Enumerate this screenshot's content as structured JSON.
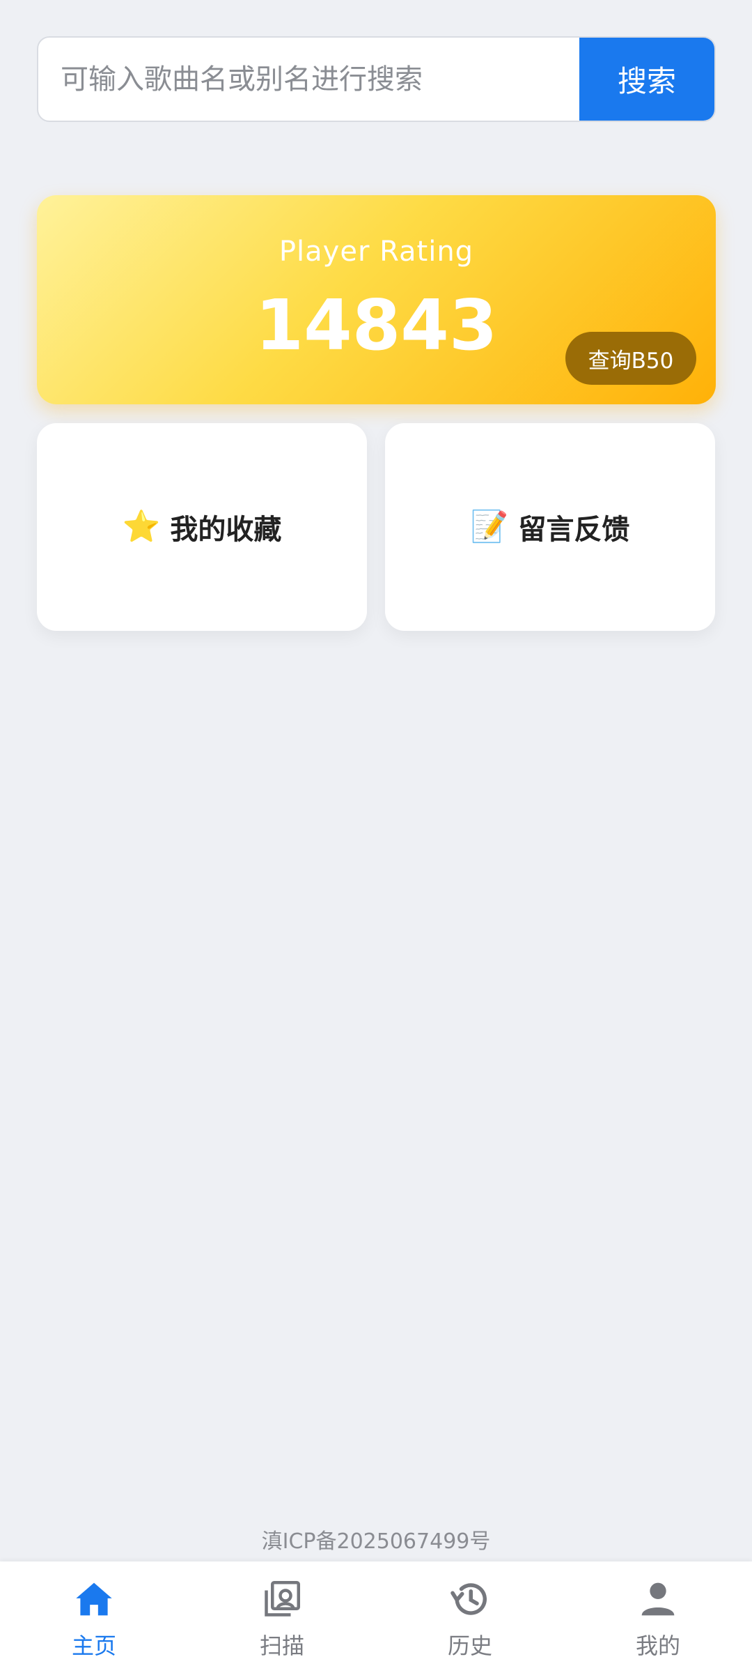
{
  "search": {
    "placeholder": "可输入歌曲名或别名进行搜索",
    "button_label": "搜索"
  },
  "rating_card": {
    "label": "Player Rating",
    "value": "14843",
    "button_label": "查询B50"
  },
  "features": [
    {
      "icon": "⭐",
      "label": "我的收藏"
    },
    {
      "icon": "📝",
      "label": "留言反馈"
    }
  ],
  "footer": {
    "icp": "滇ICP备2025067499号"
  },
  "bottom_nav": {
    "items": [
      {
        "label": "主页",
        "icon": "home-icon",
        "active": true
      },
      {
        "label": "扫描",
        "icon": "scan-icon",
        "active": false
      },
      {
        "label": "历史",
        "icon": "history-icon",
        "active": false
      },
      {
        "label": "我的",
        "icon": "user-icon",
        "active": false
      }
    ]
  },
  "colors": {
    "accent": "#1a79ee",
    "background": "#eef0f4",
    "rating_gradient_start": "#fff29a",
    "rating_gradient_end": "#ffb108",
    "b50_button": "#9a6c06"
  }
}
